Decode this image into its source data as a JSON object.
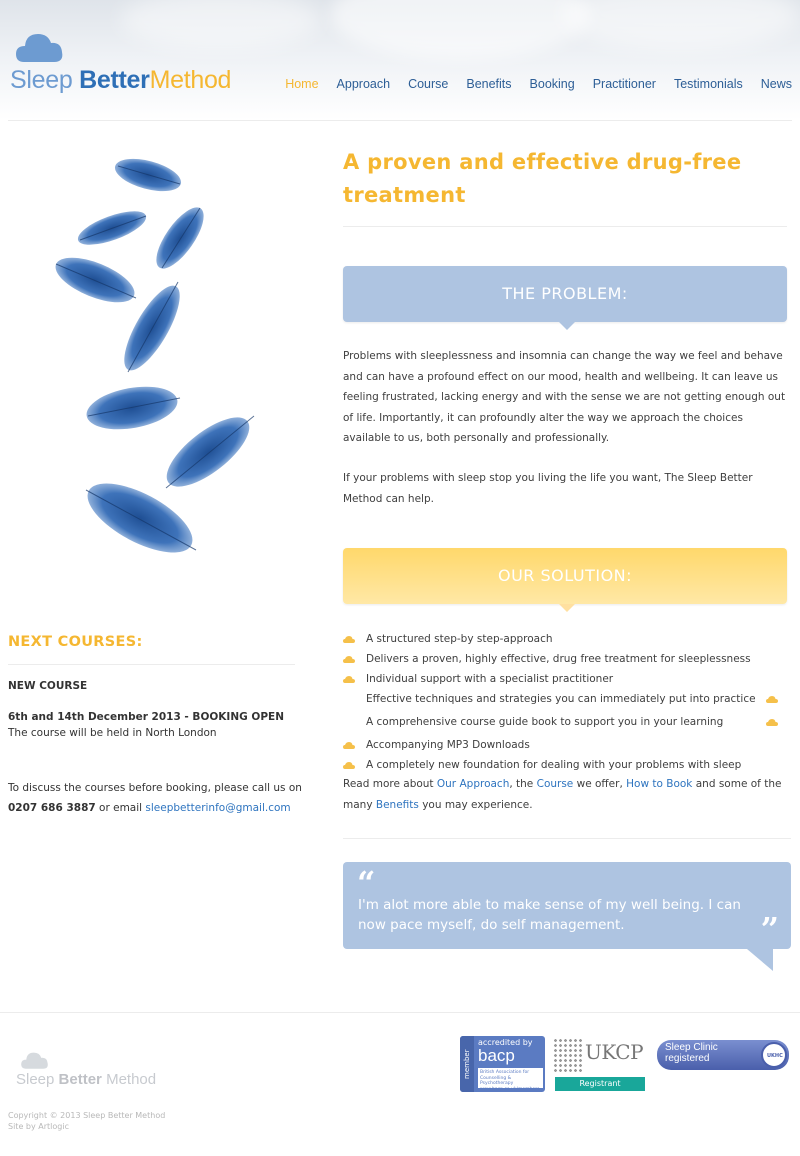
{
  "brand": {
    "logo_word1": "Sleep",
    "logo_word2": "Better",
    "logo_word3": "Method"
  },
  "nav": {
    "items": [
      {
        "label": "Home",
        "active": true
      },
      {
        "label": "Approach"
      },
      {
        "label": "Course"
      },
      {
        "label": "Benefits"
      },
      {
        "label": "Booking"
      },
      {
        "label": "Practitioner"
      },
      {
        "label": "Testimonials"
      },
      {
        "label": "News"
      }
    ]
  },
  "main": {
    "headline": "A proven and effective drug-free treatment",
    "problem": {
      "heading": "THE PROBLEM:",
      "paragraph1": "Problems with sleeplessness and insomnia can change the way we feel and behave and can have a profound effect on our mood, health and wellbeing. It can leave us feeling frustrated, lacking energy  and with the sense we are not getting enough out of life. Importantly, it can profoundly alter the way we approach the choices available to us, both personally and professionally.",
      "paragraph2": "If your problems with sleep stop you living the life you want, The Sleep Better Method can help."
    },
    "solution": {
      "heading": "OUR SOLUTION:",
      "items": [
        "A structured step-by step-approach",
        "Delivers a proven, highly effective, drug free treatment for sleeplessness",
        "Individual support with a specialist  practitioner",
        "Effective techniques and strategies you can immediately put into practice",
        "A comprehensive course guide book to support you in your learning",
        "Accompanying MP3 Downloads",
        "A completely new foundation for dealing with your problems with sleep"
      ]
    },
    "readmore": {
      "t1": "Read more about ",
      "link1": "Our Approach",
      "t2": ", the ",
      "link2": "Course",
      "t3": " we offer, ",
      "link3": "How to Book",
      "t4": " and some of the many ",
      "link4": "Benefits",
      "t5": " you may experience."
    },
    "testimonial": {
      "open_quote": "“",
      "close_quote": "”",
      "text": "I'm alot more able to make sense of my well being. I can now pace myself, do self management."
    }
  },
  "sidebar": {
    "title": "NEXT COURSES:",
    "course_label": "NEW COURSE",
    "course_dates": "6th and 14th December 2013  - BOOKING OPEN",
    "course_location": "The course will be held in North London",
    "contact_intro": "To discuss the courses before booking, please call us on",
    "phone": "0207 686 3887",
    "or_email": " or email ",
    "email": "sleepbetterinfo@gmail.com"
  },
  "footer": {
    "logo_word1": "Sleep",
    "logo_word2": "Better",
    "logo_word3": "Method",
    "copyright": "Copyright © 2013 Sleep Better Method",
    "credit": "Site by Artlogic",
    "badges": {
      "bacp_member": "member",
      "bacp_accredited": "accredited by",
      "bacp_name": "bacp",
      "bacp_sub": "British Association for Counselling & Psychotherapy www.bacp.co.uk/members",
      "ukcp_name": "UKCP",
      "ukcp_registrant": "Registrant",
      "sleepclinic_line1": "Sleep Clinic",
      "sleepclinic_line2": "registered",
      "sleepclinic_circle": "UKHC"
    }
  },
  "colors": {
    "accent_yellow": "#f5b731",
    "brand_blue": "#2e6fb6",
    "nav_blue": "#2d5e96",
    "banner_blue": "#aec4e1",
    "link_blue": "#2e74bf"
  }
}
